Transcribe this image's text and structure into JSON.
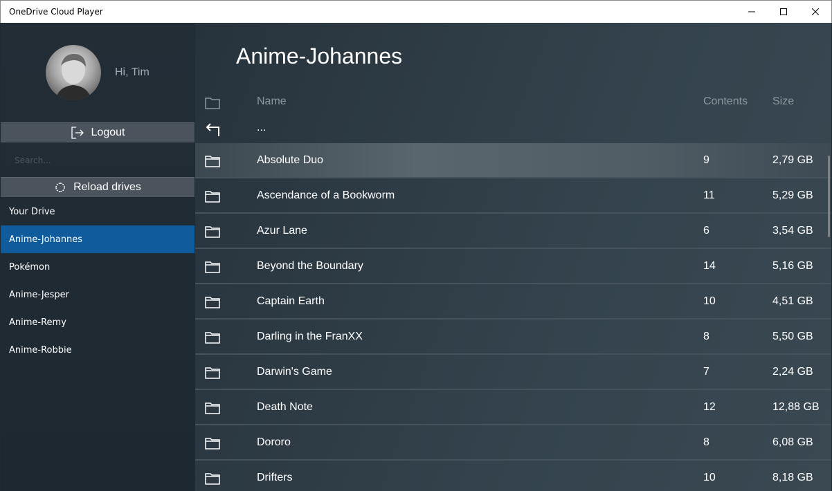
{
  "window": {
    "title": "OneDrive Cloud Player"
  },
  "sidebar": {
    "greeting": "Hi, Tim",
    "logout_label": "Logout",
    "search_placeholder": "Search...",
    "reload_label": "Reload drives",
    "drives": [
      {
        "label": "Your Drive",
        "active": false
      },
      {
        "label": "Anime-Johannes",
        "active": true
      },
      {
        "label": "Pokémon",
        "active": false
      },
      {
        "label": "Anime-Jesper",
        "active": false
      },
      {
        "label": "Anime-Remy",
        "active": false
      },
      {
        "label": "Anime-Robbie",
        "active": false
      }
    ]
  },
  "main": {
    "title": "Anime-Johannes",
    "columns": {
      "name": "Name",
      "contents": "Contents",
      "size": "Size"
    },
    "parent_label": "...",
    "folders": [
      {
        "name": "Absolute Duo",
        "contents": "9",
        "size": "2,79 GB"
      },
      {
        "name": "Ascendance of a Bookworm",
        "contents": "11",
        "size": "5,29 GB"
      },
      {
        "name": "Azur Lane",
        "contents": "6",
        "size": "3,54 GB"
      },
      {
        "name": "Beyond the Boundary",
        "contents": "14",
        "size": "5,16 GB"
      },
      {
        "name": "Captain Earth",
        "contents": "10",
        "size": "4,51 GB"
      },
      {
        "name": "Darling in the FranXX",
        "contents": "8",
        "size": "5,50 GB"
      },
      {
        "name": "Darwin's Game",
        "contents": "7",
        "size": "2,24 GB"
      },
      {
        "name": "Death Note",
        "contents": "12",
        "size": "12,88 GB"
      },
      {
        "name": "Dororo",
        "contents": "8",
        "size": "6,08 GB"
      },
      {
        "name": "Drifters",
        "contents": "10",
        "size": "8,18 GB"
      }
    ]
  },
  "icons": {
    "folder": "folder-icon",
    "back": "back-arrow-icon",
    "logout": "logout-icon",
    "reload": "reload-icon"
  }
}
